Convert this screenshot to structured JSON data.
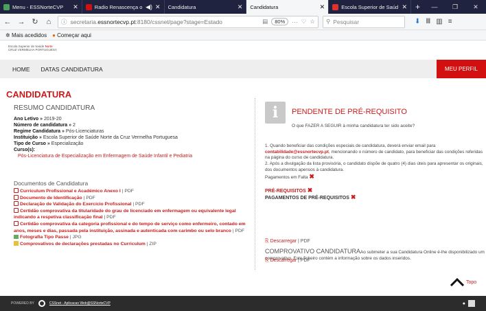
{
  "browser": {
    "tabs": [
      {
        "title": "Menu - ESSNorteCVP",
        "color": "#4aa05a"
      },
      {
        "title": "Radio Renascença o",
        "color": "#d31010",
        "extra": "◀)"
      },
      {
        "title": "Candidatura",
        "color": ""
      },
      {
        "title": "Candidatura",
        "color": "",
        "active": true
      },
      {
        "title": "Escola Superior de Saúd",
        "color": "#e03030"
      }
    ],
    "url_prefix": "secretaria.",
    "url_host": "essnortecvp.pt",
    "url_rest": ":8180/cssnet/page?stage=Estado",
    "zoom": "80%",
    "search_placeholder": "Pesquisar",
    "bookmarks": [
      "Mais acedidos",
      "Começar aqui"
    ]
  },
  "brand": {
    "line1a": "Escola Superior de Saúde",
    "line1b": "Norte",
    "line2": "CRUZ VERMELHA PORTUGUESA"
  },
  "menu": {
    "home": "HOME",
    "datas": "DATAS CANDIDATURA",
    "perfil": "MEU PERFIL"
  },
  "page": {
    "title": "CANDIDATURA",
    "resumo_title": "RESUMO CANDIDATURA",
    "info": [
      {
        "label": "Ano Letivo",
        "value": "2019-20"
      },
      {
        "label": "Número de candidatura",
        "value": "2"
      },
      {
        "label": "Regime Candidatura",
        "value": "Pós-Licenciaturas"
      },
      {
        "label": "Instituição",
        "value": "Escola Superior de Saúde Norte da Cruz Vermelha Portuguesa"
      },
      {
        "label": "Tipo de Curso",
        "value": "Especialização"
      }
    ],
    "cursos_label": "Curso(s):",
    "curso": "Pós-Licenciatura de Especialização em Enfermagem de Saúde Infantil e Pediatria",
    "docs_title": "Documentos de Candidatura",
    "docs": [
      {
        "name": "Curriculum Profissional e Académico Anexo I",
        "type": "PDF",
        "icon": "pdf"
      },
      {
        "name": "Documento de Identificação",
        "type": "PDF",
        "icon": "pdf"
      },
      {
        "name": "Declaração de Validação do Exercício Profissional",
        "type": "PDF",
        "icon": "pdf"
      },
      {
        "name": "Certidão comprovativa da titularidade do grau de licenciado em enfermagem ou equivalente legal indicando a respetiva classificação final",
        "type": "PDF",
        "icon": "pdf"
      },
      {
        "name": "Certidão comprovativa da categoria profissional e do tempo de serviço como enfermeiro, contado em anos, meses e dias, passada pela instituição, assinada e autenticada com carimbo ou selo branco",
        "type": "PDF",
        "icon": "pdf"
      },
      {
        "name": "Fotografia Tipo Passe",
        "type": "JPG",
        "icon": "img"
      },
      {
        "name": "Comprovativos de declarações prestadas no Curriculum",
        "type": "ZIP",
        "icon": "zip"
      }
    ],
    "pend_title": "PENDENTE DE PRÉ-REQUISITO",
    "pend_q": "O que FAZER A SEGUIR à minha candidatura ter sido aceite?",
    "instr1a": "1. Quando beneficiar das condições especiais de candidatura, deverá enviar email para",
    "instr1_email": "contabilidade@essnortecvp.pt",
    "instr1b": ", mencionando o número de candidato, para beneficiar das condições referidas na página do curso de candidatura.",
    "instr2": "2. Após a divulgação da lista provisória, o candidato dispõe de quatro (4) dias úteis para apresentar os originais, dos documentos apensos à candidatura.",
    "pagamentos_falta": "Pagamentos em Falta",
    "prereq": "PRÉ-REQUISITOS",
    "pag_prereq": "PAGAMENTOS DE PRÉ-REQUISITOS",
    "descarregar": "Descarregar",
    "pdf": "PDF",
    "comprov_title": "COMPROVATIVO CANDIDATURA",
    "comprov_text": "Ao submeter a sua Candidatura Online é-lhe disponibilizado um comprovativo. Este ficheiro contém a informação sobre os dados inseridos.",
    "topo": "Topo"
  },
  "footer": {
    "powered": "POWERED BY",
    "link": "CSSnet - Aplicacao Web@SSNorteCVP"
  }
}
